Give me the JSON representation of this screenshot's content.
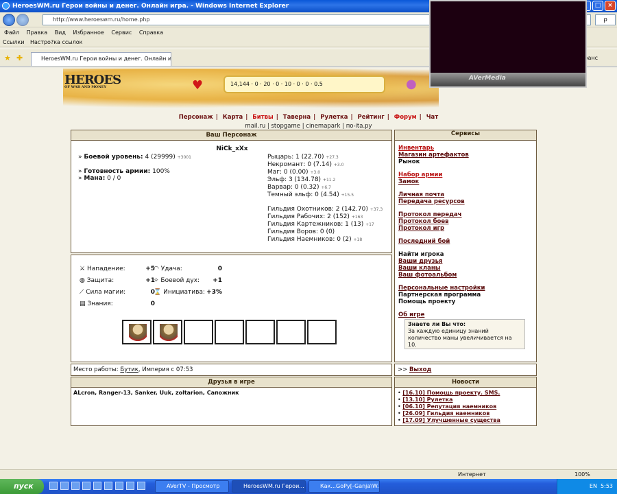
{
  "window": {
    "title": "HeroesWM.ru Герои войны и денег. Онлайн игра. - Windows Internet Explorer",
    "controls": [
      "_",
      "□",
      "×"
    ]
  },
  "browser": {
    "address": "http://www.heroeswm.ru/home.php",
    "search_label": "ρ",
    "menu": [
      "Файл",
      "Правка",
      "Вид",
      "Избранное",
      "Сервис",
      "Справка"
    ],
    "links_label": "Ссылки",
    "links_item": "Настро?ка ссылок",
    "tab_title": "HeroesWM.ru Герои войны и денег. Онлайн игра",
    "tab_right": "ранс"
  },
  "video_overlay": {
    "brand": "AVerMedia"
  },
  "game": {
    "logo": "HEROES",
    "logo_sub": "OF WAR AND MONEY",
    "resources": "14,144 · 0 · 20 · 0 · 10 · 0 · 0 · 0.5"
  },
  "nav": {
    "main": [
      "Персонаж",
      "Карта",
      "Битвы",
      "Таверна",
      "Рулетка",
      "Рейтинг",
      "Форум",
      "Чат"
    ],
    "separator": "|",
    "sub": [
      "mail.ru",
      "stopgame",
      "cinemapark",
      "по-ita.ру"
    ]
  },
  "character_panel": {
    "header": "Ваш Персонаж",
    "nick": "NiCk_xXx",
    "level_label": "Боевой уровень:",
    "level_value": "4 (29999)",
    "level_delta": "+3001",
    "army_label": "Готовность армии:",
    "army_value": "100%",
    "mana_label": "Мана:",
    "mana_value": "0 / 0",
    "factions": [
      {
        "name": "Рыцарь:",
        "value": "1 (22.70)",
        "delta": "+27.3"
      },
      {
        "name": "Некромант:",
        "value": "0 (7.14)",
        "delta": "+3.0"
      },
      {
        "name": "Маг:",
        "value": "0 (0.00)",
        "delta": "+3.0"
      },
      {
        "name": "Эльф:",
        "value": "3 (134.78)",
        "delta": "+11.2"
      },
      {
        "name": "Варвар:",
        "value": "0 (0.32)",
        "delta": "+6.7"
      },
      {
        "name": "Темный эльф:",
        "value": "0 (4.54)",
        "delta": "+15.5"
      }
    ],
    "guilds": [
      {
        "name": "Гильдия Охотников:",
        "value": "2 (142.70)",
        "delta": "+37.3"
      },
      {
        "name": "Гильдия Рабочих:",
        "value": "2 (152)",
        "delta": "+163"
      },
      {
        "name": "Гильдия Картежников:",
        "value": "1 (13)",
        "delta": "+17"
      },
      {
        "name": "Гильдия Воров:",
        "value": "0 (0)",
        "delta": ""
      },
      {
        "name": "Гильдия Наемников:",
        "value": "0 (2)",
        "delta": "+18"
      }
    ]
  },
  "stats": {
    "left": [
      {
        "icon": "sword-icon",
        "label": "Нападение:",
        "value": "+5"
      },
      {
        "icon": "shield-icon",
        "label": "Защита:",
        "value": "+1"
      },
      {
        "icon": "wand-icon",
        "label": "Сила магии:",
        "value": "0"
      },
      {
        "icon": "book-icon",
        "label": "Знания:",
        "value": "0"
      }
    ],
    "right": [
      {
        "icon": "rainbow-icon",
        "label": "Удача:",
        "value": "0"
      },
      {
        "icon": "morale-icon",
        "label": "Боевой дух:",
        "value": "+1"
      },
      {
        "icon": "hourglass-icon",
        "label": "Инициатива:",
        "value": "+3%"
      }
    ]
  },
  "work": {
    "prefix": "Место работы:",
    "place": "Бутик",
    "suffix": ", Империя с 07:53"
  },
  "friends": {
    "header": "Друзья в игре",
    "list": "ALcron, Ranger-13, Sanker, Uuk, zoltarion, Сапожник"
  },
  "services": {
    "header": "Сервисы",
    "groups": [
      [
        {
          "label": "Инвентарь",
          "style": "red"
        },
        {
          "label": "Магазин артефактов",
          "style": "link"
        },
        {
          "label": "Рынок",
          "style": "plain"
        }
      ],
      [
        {
          "label": "Набор армии",
          "style": "red"
        },
        {
          "label": "Замок",
          "style": "link"
        }
      ],
      [
        {
          "label": "Личная почта",
          "style": "link"
        },
        {
          "label": "Передача ресурсов",
          "style": "link"
        }
      ],
      [
        {
          "label": "Протокол передач",
          "style": "link"
        },
        {
          "label": "Протокол боев",
          "style": "link"
        },
        {
          "label": "Протокол игр",
          "style": "link"
        }
      ],
      [
        {
          "label": "Последний бой",
          "style": "link"
        }
      ],
      [
        {
          "label": "Найти игрока",
          "style": "plain"
        },
        {
          "label": "Ваши друзья",
          "style": "link"
        },
        {
          "label": "Ваши кланы",
          "style": "link"
        },
        {
          "label": "Ваш фотоальбом",
          "style": "link"
        }
      ],
      [
        {
          "label": "Персональные настройки",
          "style": "link"
        },
        {
          "label": "Партнерская программа",
          "style": "plain"
        },
        {
          "label": "Помощь проекту",
          "style": "plain"
        }
      ],
      [
        {
          "label": "Об игре",
          "style": "link"
        }
      ]
    ],
    "tip_title": "Знаете ли Вы что:",
    "tip_text": "За каждую единицу знаний количество маны увеличивается на 10."
  },
  "exit": {
    "prefix": ">>",
    "label": "Выход"
  },
  "news": {
    "header": "Новости",
    "items": [
      "[16.10] Помощь проекту. SMS.",
      "[13.10] Рулетка",
      "[06.10] Репутация наемников",
      "[26.09] Гильдия наемников",
      "[17.09] Улучшенные существа"
    ]
  },
  "statusbar": {
    "zone": "Интернет",
    "zoom": "100%"
  },
  "taskbar": {
    "start": "пуск",
    "tasks": [
      "AVerTV - Просмотр",
      "HeroesWM.ru Герои...",
      "Как...GoPy[-Ganja\\W..."
    ],
    "tray_lang": "EN",
    "tray_time": "5:53"
  }
}
